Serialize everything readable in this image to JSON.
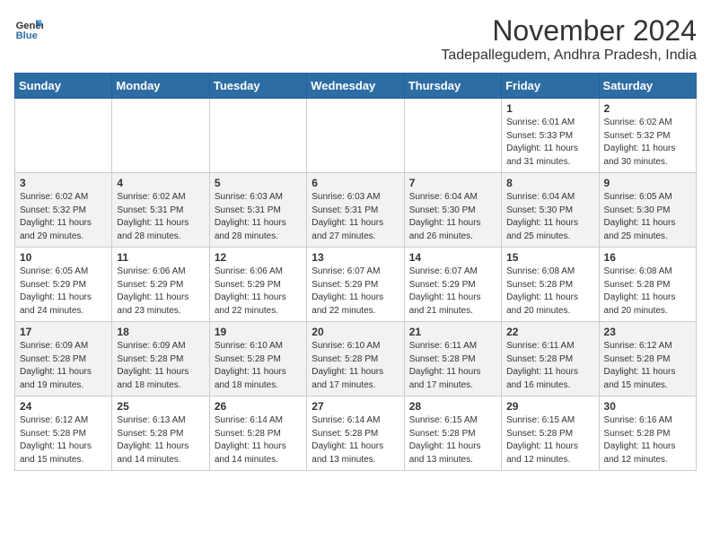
{
  "logo": {
    "line1": "General",
    "line2": "Blue"
  },
  "header": {
    "month": "November 2024",
    "location": "Tadepallegudem, Andhra Pradesh, India"
  },
  "weekdays": [
    "Sunday",
    "Monday",
    "Tuesday",
    "Wednesday",
    "Thursday",
    "Friday",
    "Saturday"
  ],
  "weeks": [
    [
      {
        "day": "",
        "info": ""
      },
      {
        "day": "",
        "info": ""
      },
      {
        "day": "",
        "info": ""
      },
      {
        "day": "",
        "info": ""
      },
      {
        "day": "",
        "info": ""
      },
      {
        "day": "1",
        "info": "Sunrise: 6:01 AM\nSunset: 5:33 PM\nDaylight: 11 hours and 31 minutes."
      },
      {
        "day": "2",
        "info": "Sunrise: 6:02 AM\nSunset: 5:32 PM\nDaylight: 11 hours and 30 minutes."
      }
    ],
    [
      {
        "day": "3",
        "info": "Sunrise: 6:02 AM\nSunset: 5:32 PM\nDaylight: 11 hours and 29 minutes."
      },
      {
        "day": "4",
        "info": "Sunrise: 6:02 AM\nSunset: 5:31 PM\nDaylight: 11 hours and 28 minutes."
      },
      {
        "day": "5",
        "info": "Sunrise: 6:03 AM\nSunset: 5:31 PM\nDaylight: 11 hours and 28 minutes."
      },
      {
        "day": "6",
        "info": "Sunrise: 6:03 AM\nSunset: 5:31 PM\nDaylight: 11 hours and 27 minutes."
      },
      {
        "day": "7",
        "info": "Sunrise: 6:04 AM\nSunset: 5:30 PM\nDaylight: 11 hours and 26 minutes."
      },
      {
        "day": "8",
        "info": "Sunrise: 6:04 AM\nSunset: 5:30 PM\nDaylight: 11 hours and 25 minutes."
      },
      {
        "day": "9",
        "info": "Sunrise: 6:05 AM\nSunset: 5:30 PM\nDaylight: 11 hours and 25 minutes."
      }
    ],
    [
      {
        "day": "10",
        "info": "Sunrise: 6:05 AM\nSunset: 5:29 PM\nDaylight: 11 hours and 24 minutes."
      },
      {
        "day": "11",
        "info": "Sunrise: 6:06 AM\nSunset: 5:29 PM\nDaylight: 11 hours and 23 minutes."
      },
      {
        "day": "12",
        "info": "Sunrise: 6:06 AM\nSunset: 5:29 PM\nDaylight: 11 hours and 22 minutes."
      },
      {
        "day": "13",
        "info": "Sunrise: 6:07 AM\nSunset: 5:29 PM\nDaylight: 11 hours and 22 minutes."
      },
      {
        "day": "14",
        "info": "Sunrise: 6:07 AM\nSunset: 5:29 PM\nDaylight: 11 hours and 21 minutes."
      },
      {
        "day": "15",
        "info": "Sunrise: 6:08 AM\nSunset: 5:28 PM\nDaylight: 11 hours and 20 minutes."
      },
      {
        "day": "16",
        "info": "Sunrise: 6:08 AM\nSunset: 5:28 PM\nDaylight: 11 hours and 20 minutes."
      }
    ],
    [
      {
        "day": "17",
        "info": "Sunrise: 6:09 AM\nSunset: 5:28 PM\nDaylight: 11 hours and 19 minutes."
      },
      {
        "day": "18",
        "info": "Sunrise: 6:09 AM\nSunset: 5:28 PM\nDaylight: 11 hours and 18 minutes."
      },
      {
        "day": "19",
        "info": "Sunrise: 6:10 AM\nSunset: 5:28 PM\nDaylight: 11 hours and 18 minutes."
      },
      {
        "day": "20",
        "info": "Sunrise: 6:10 AM\nSunset: 5:28 PM\nDaylight: 11 hours and 17 minutes."
      },
      {
        "day": "21",
        "info": "Sunrise: 6:11 AM\nSunset: 5:28 PM\nDaylight: 11 hours and 17 minutes."
      },
      {
        "day": "22",
        "info": "Sunrise: 6:11 AM\nSunset: 5:28 PM\nDaylight: 11 hours and 16 minutes."
      },
      {
        "day": "23",
        "info": "Sunrise: 6:12 AM\nSunset: 5:28 PM\nDaylight: 11 hours and 15 minutes."
      }
    ],
    [
      {
        "day": "24",
        "info": "Sunrise: 6:12 AM\nSunset: 5:28 PM\nDaylight: 11 hours and 15 minutes."
      },
      {
        "day": "25",
        "info": "Sunrise: 6:13 AM\nSunset: 5:28 PM\nDaylight: 11 hours and 14 minutes."
      },
      {
        "day": "26",
        "info": "Sunrise: 6:14 AM\nSunset: 5:28 PM\nDaylight: 11 hours and 14 minutes."
      },
      {
        "day": "27",
        "info": "Sunrise: 6:14 AM\nSunset: 5:28 PM\nDaylight: 11 hours and 13 minutes."
      },
      {
        "day": "28",
        "info": "Sunrise: 6:15 AM\nSunset: 5:28 PM\nDaylight: 11 hours and 13 minutes."
      },
      {
        "day": "29",
        "info": "Sunrise: 6:15 AM\nSunset: 5:28 PM\nDaylight: 11 hours and 12 minutes."
      },
      {
        "day": "30",
        "info": "Sunrise: 6:16 AM\nSunset: 5:28 PM\nDaylight: 11 hours and 12 minutes."
      }
    ]
  ]
}
